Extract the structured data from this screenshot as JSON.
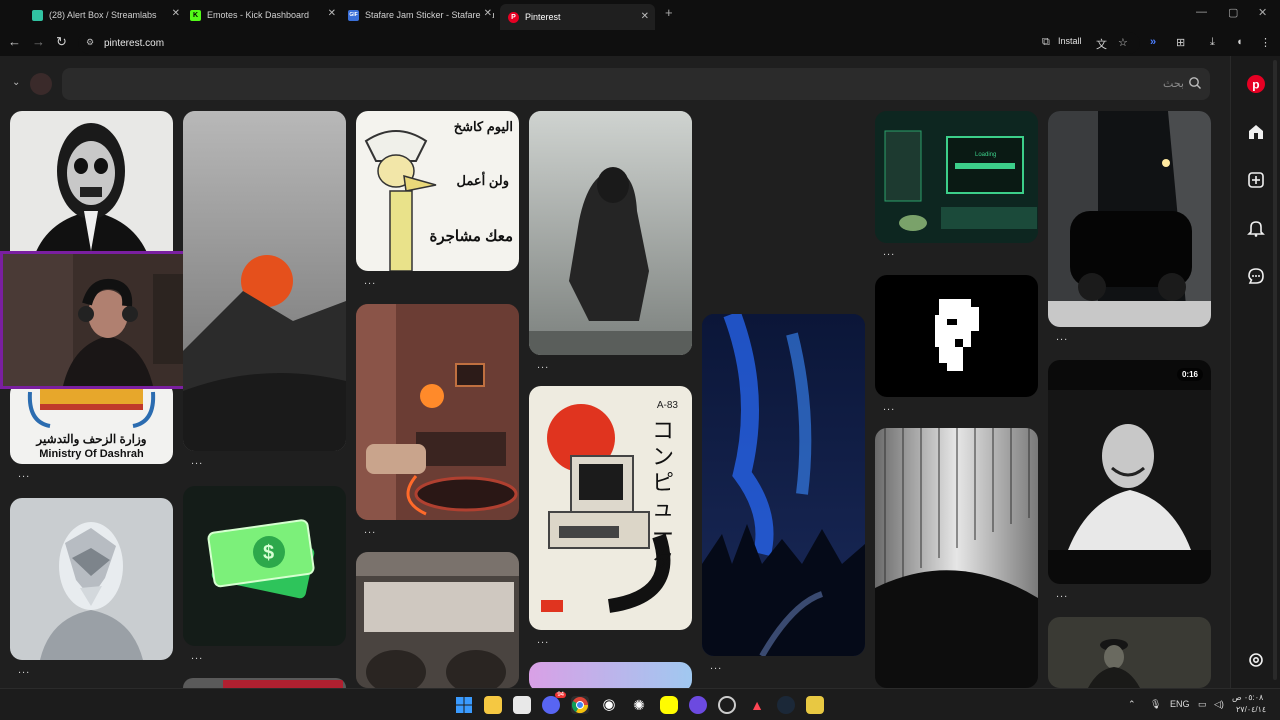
{
  "tabs": [
    {
      "title": "(28) Alert Box / Streamlabs",
      "favicon": "streamlabs-icon",
      "color": "#31c3a2"
    },
    {
      "title": "Emotes - Kick Dashboard",
      "favicon": "kick-icon",
      "color": "#53fc18"
    },
    {
      "title": "Stafare Jam Sticker - Stafare Jam",
      "favicon": "gif-icon",
      "color": "#3a6fd8"
    },
    {
      "title": "Pinterest",
      "favicon": "pinterest-icon",
      "color": "#e60023"
    }
  ],
  "address": {
    "url": "pinterest.com",
    "install_label": "Install"
  },
  "search": {
    "placeholder": "بحث"
  },
  "pins": [
    {
      "name": "pin-skull-mask",
      "dots": "..."
    },
    {
      "name": "pin-desert-sun",
      "dots": "..."
    },
    {
      "name": "pin-arabic-cartoon",
      "dots": "...",
      "text_top": "اليوم كاشخ",
      "text_mid": "ولن أعمل",
      "text_bot": "معك مشاجرة"
    },
    {
      "name": "pin-soldier-fog",
      "dots": "..."
    },
    {
      "name": "pin-retro-computer",
      "dots": "...",
      "text": "Loading"
    },
    {
      "name": "pin-dark-car",
      "dots": "..."
    },
    {
      "name": "pin-ministry-logo",
      "dots": "...",
      "text_ar": "وزارة الزحف والتدشير",
      "text_en": "Ministry Of Dashrah"
    },
    {
      "name": "pin-cozy-room",
      "dots": "..."
    },
    {
      "name": "pin-computer-poster",
      "dots": "...",
      "text_code": "A-83",
      "text_jp": "コンピュータ"
    },
    {
      "name": "pin-aurora",
      "dots": "..."
    },
    {
      "name": "pin-pixel-face",
      "dots": "..."
    },
    {
      "name": "pin-laughing-man",
      "dots": "...",
      "badge": "0:16"
    },
    {
      "name": "pin-crystal-head",
      "dots": "..."
    },
    {
      "name": "pin-money-icon",
      "dots": "..."
    },
    {
      "name": "pin-interior",
      "dots": ""
    },
    {
      "name": "pin-gradient-laptop",
      "dots": ""
    },
    {
      "name": "pin-silver-waves",
      "dots": ""
    },
    {
      "name": "pin-officer",
      "dots": ""
    },
    {
      "name": "pin-red-partial",
      "dots": ""
    }
  ],
  "taskbar": {
    "lang": "ENG",
    "time": "٠٥:٠٨ ص",
    "date": "٢٧/٠٤/١٤",
    "discord_badge": "94"
  }
}
